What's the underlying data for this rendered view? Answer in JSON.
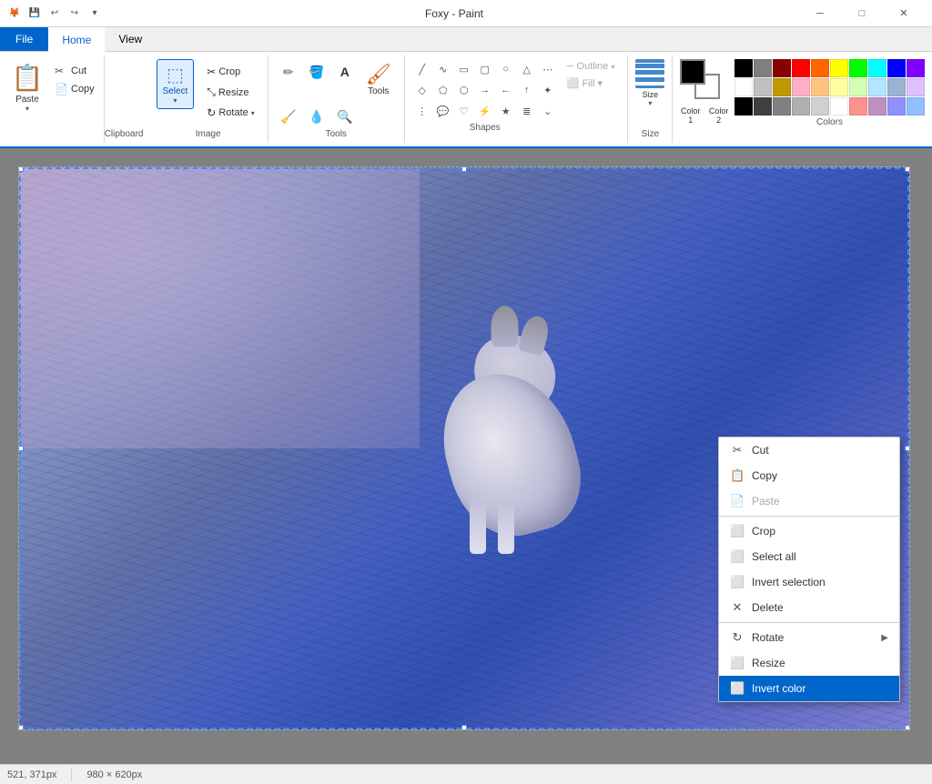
{
  "titleBar": {
    "title": "Foxy - Paint",
    "icons": [
      "save-icon",
      "undo-icon",
      "redo-icon",
      "more-icon"
    ]
  },
  "menuBar": {
    "tabs": [
      "File",
      "Home",
      "View"
    ]
  },
  "ribbon": {
    "clipboard": {
      "label": "Clipboard",
      "paste": "Paste",
      "cut": "Cut",
      "copy": "Copy"
    },
    "image": {
      "label": "Image",
      "crop": "Crop",
      "resize": "Resize",
      "rotate": "Rotate",
      "select": "Select"
    },
    "tools": {
      "label": "Tools"
    },
    "shapes": {
      "label": "Shapes",
      "outline": "Outline",
      "fill": "Fill ▾"
    },
    "size": {
      "label": "Size"
    },
    "colors": {
      "label": "Colors",
      "color1": "Color 1",
      "color2": "Color 2",
      "palette": [
        "#000000",
        "#7f7f7f",
        "#880000",
        "#ff0000",
        "#ff6600",
        "#ffff00",
        "#00ff00",
        "#00ffff",
        "#0000ff",
        "#8000ff",
        "#ffffff",
        "#c0c0c0",
        "#bf9900",
        "#ffaec8",
        "#ffc580",
        "#ffffa0",
        "#d4ffb4",
        "#b4e4ff",
        "#99b4d1",
        "#e0c0ff",
        "#000000",
        "#404040",
        "#808080",
        "#b0b0b0",
        "#d0d0d0",
        "#ffffff",
        "#ff9090",
        "#c090c0",
        "#9090ff",
        "#90c0ff"
      ]
    }
  },
  "contextMenu": {
    "items": [
      {
        "label": "Cut",
        "icon": "✂",
        "disabled": false,
        "hasArrow": false
      },
      {
        "label": "Copy",
        "icon": "📋",
        "disabled": false,
        "hasArrow": false
      },
      {
        "label": "Paste",
        "icon": "📄",
        "disabled": true,
        "hasArrow": false
      },
      {
        "label": "Crop",
        "icon": "⬜",
        "disabled": false,
        "hasArrow": false
      },
      {
        "label": "Select all",
        "icon": "⬜",
        "disabled": false,
        "hasArrow": false
      },
      {
        "label": "Invert selection",
        "icon": "⬜",
        "disabled": false,
        "hasArrow": false
      },
      {
        "label": "Delete",
        "icon": "✕",
        "disabled": false,
        "hasArrow": false
      },
      {
        "label": "Rotate",
        "icon": "↻",
        "disabled": false,
        "hasArrow": true
      },
      {
        "label": "Resize",
        "icon": "⬜",
        "disabled": false,
        "hasArrow": false
      },
      {
        "label": "Invert color",
        "icon": "⬜",
        "disabled": false,
        "hasArrow": false,
        "highlighted": true
      }
    ]
  },
  "statusBar": {
    "coords": "521, 371px",
    "size": "980 × 620px"
  }
}
